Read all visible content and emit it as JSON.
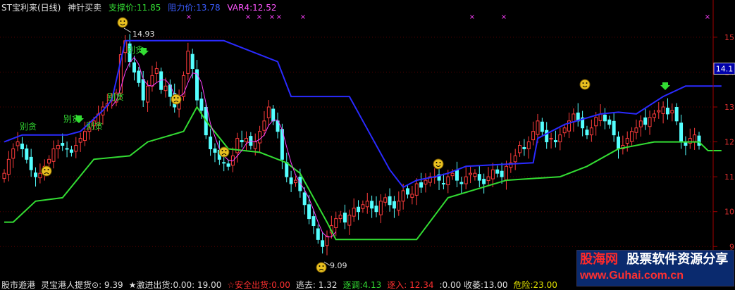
{
  "header": {
    "title": "ST宝利来(日线)",
    "indicator": "神针买卖",
    "support": "支撑价:11.85",
    "resistance": "阻力价:13.78",
    "var4": "VAR4:12.52"
  },
  "footer": {
    "items": [
      {
        "text": "股市遊港",
        "color": "#e0e0e0"
      },
      {
        "text": "灵宝港人提货⊙: 9.39",
        "color": "#e0e0e0"
      },
      {
        "text": "★激进出货:0.00: 19.00",
        "color": "#e0e0e0"
      },
      {
        "text": "☆安全出货:0.00",
        "color": "#ff3030"
      },
      {
        "text": "逃去: 1.32",
        "color": "#e0e0e0"
      },
      {
        "text": "逐调:4.13",
        "color": "#33dd33"
      },
      {
        "text": "逐入: 12.34",
        "color": "#ff3030"
      },
      {
        "text": ":0.00 收萎:13.00",
        "color": "#e0e0e0"
      },
      {
        "text": "危险:23.00",
        "color": "#e0e000"
      }
    ]
  },
  "watermark": {
    "name": "股海网",
    "slogan": "股票软件资源分享",
    "url": "www.Guhai.com.cn"
  },
  "chart_data": {
    "type": "candlestick",
    "y_axis": {
      "ticks": [
        9,
        10,
        11,
        12,
        13,
        14,
        15
      ],
      "ylim": [
        8.4,
        15.3
      ],
      "current_price_label": "14.1"
    },
    "annotations": {
      "high_label": "14.93",
      "low_label": "9.09",
      "signal_text": "别贪",
      "cross_mark": "×"
    },
    "resistance_line": [
      [
        0,
        12.0
      ],
      [
        4,
        12.2
      ],
      [
        14,
        12.2
      ],
      [
        17,
        12.3
      ],
      [
        22,
        12.9
      ],
      [
        24,
        13.2
      ],
      [
        27,
        14.9
      ],
      [
        49,
        14.9
      ],
      [
        61,
        14.3
      ],
      [
        64,
        13.3
      ],
      [
        77,
        13.3
      ],
      [
        86,
        11.2
      ],
      [
        89,
        10.7
      ],
      [
        92,
        10.9
      ],
      [
        96,
        11.0
      ],
      [
        99,
        11.1
      ],
      [
        103,
        11.3
      ],
      [
        118,
        11.4
      ],
      [
        119,
        12.1
      ],
      [
        125,
        12.5
      ],
      [
        133,
        12.8
      ],
      [
        137,
        12.85
      ],
      [
        141,
        12.8
      ],
      [
        147,
        13.3
      ],
      [
        152,
        13.6
      ],
      [
        160,
        13.6
      ]
    ],
    "support_line": [
      [
        0,
        9.7
      ],
      [
        2,
        9.7
      ],
      [
        7,
        10.3
      ],
      [
        13,
        10.4
      ],
      [
        20,
        11.5
      ],
      [
        28,
        11.6
      ],
      [
        32,
        12.0
      ],
      [
        40,
        12.3
      ],
      [
        43,
        13.0
      ],
      [
        45,
        12.6
      ],
      [
        50,
        11.8
      ],
      [
        57,
        11.7
      ],
      [
        63,
        11.4
      ],
      [
        66,
        11.1
      ],
      [
        72,
        9.7
      ],
      [
        74,
        9.2
      ],
      [
        92,
        9.2
      ],
      [
        99,
        10.4
      ],
      [
        112,
        10.9
      ],
      [
        124,
        11.0
      ],
      [
        130,
        11.3
      ],
      [
        137,
        11.8
      ],
      [
        145,
        12.0
      ],
      [
        155,
        12.0
      ],
      [
        157,
        11.75
      ],
      [
        160,
        11.75
      ]
    ],
    "close_prices": [
      11.1,
      11.5,
      11.8,
      12.0,
      11.8,
      11.5,
      11.2,
      11.0,
      11.1,
      11.3,
      11.5,
      11.8,
      11.9,
      11.9,
      11.8,
      11.7,
      11.9,
      12.1,
      12.3,
      12.4,
      12.6,
      12.8,
      13.0,
      13.1,
      13.2,
      13.4,
      14.5,
      14.9,
      14.3,
      14.0,
      13.7,
      13.2,
      13.6,
      13.9,
      14.1,
      13.5,
      13.6,
      13.3,
      13.0,
      13.3,
      13.9,
      14.6,
      14.1,
      13.2,
      12.9,
      12.2,
      11.8,
      11.7,
      11.5,
      11.4,
      11.3,
      11.6,
      12.1,
      12.0,
      12.1,
      11.9,
      12.0,
      12.3,
      12.6,
      13.0,
      12.6,
      12.3,
      11.5,
      11.0,
      10.8,
      10.9,
      10.6,
      10.2,
      9.8,
      9.6,
      9.2,
      9.0,
      9.3,
      9.6,
      9.8,
      9.9,
      9.7,
      9.9,
      10.1,
      10.0,
      10.2,
      10.3,
      10.1,
      10.0,
      10.3,
      10.4,
      10.2,
      10.1,
      10.3,
      10.6,
      10.5,
      10.5,
      10.8,
      10.7,
      10.9,
      11.0,
      11.0,
      10.9,
      10.8,
      11.0,
      11.1,
      10.9,
      10.8,
      11.0,
      11.1,
      11.1,
      10.9,
      10.8,
      11.0,
      11.2,
      11.1,
      11.0,
      11.3,
      11.4,
      11.6,
      11.9,
      11.8,
      12.0,
      12.3,
      12.6,
      12.3,
      12.0,
      12.1,
      12.0,
      12.2,
      12.4,
      12.6,
      12.8,
      12.6,
      12.4,
      12.2,
      12.4,
      12.7,
      12.8,
      12.6,
      12.5,
      12.2,
      11.8,
      11.9,
      12.1,
      12.3,
      12.4,
      12.6,
      12.5,
      12.7,
      12.8,
      12.9,
      13.0,
      12.8,
      12.9,
      12.6,
      12.0,
      11.9,
      12.1,
      12.2,
      11.9
    ]
  }
}
